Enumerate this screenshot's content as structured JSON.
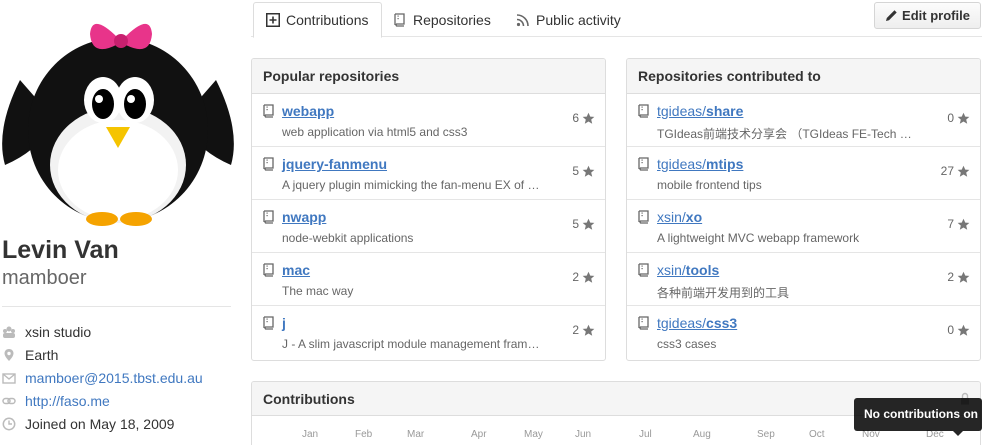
{
  "profile": {
    "full_name": "Levin Van",
    "username": "mamboer",
    "details": [
      {
        "icon": "organization-icon",
        "text": "xsin studio",
        "link": false
      },
      {
        "icon": "location-icon",
        "text": "Earth",
        "link": false
      },
      {
        "icon": "mail-icon",
        "text": "mamboer@2015.tbst.edu.au",
        "link": true
      },
      {
        "icon": "link-icon",
        "text": "http://faso.me",
        "link": true
      },
      {
        "icon": "clock-icon",
        "text": "Joined on May 18, 2009",
        "link": false
      }
    ]
  },
  "tabs": [
    {
      "label": "Contributions",
      "icon": "contributions-icon",
      "selected": true
    },
    {
      "label": "Repositories",
      "icon": "repo-icon",
      "selected": false
    },
    {
      "label": "Public activity",
      "icon": "rss-icon",
      "selected": false
    }
  ],
  "edit_profile_label": "Edit profile",
  "popular": {
    "title": "Popular repositories",
    "repos": [
      {
        "name": "webapp",
        "desc": "web application via html5 and css3",
        "stars": "6"
      },
      {
        "name": "jquery-fanmenu",
        "desc": "A jquery plugin mimicking the fan-menu EX of Path app.",
        "stars": "5"
      },
      {
        "name": "nwapp",
        "desc": "node-webkit applications",
        "stars": "5"
      },
      {
        "name": "mac",
        "desc": "The mac way",
        "stars": "2"
      },
      {
        "name": "j",
        "desc": "J - A slim javascript module management framework",
        "stars": "2"
      }
    ]
  },
  "contributed": {
    "title": "Repositories contributed to",
    "repos": [
      {
        "owner": "tgideas/",
        "name": "share",
        "desc": "TGIdeas前端技术分享会 （TGIdeas FE-Tech Share）",
        "stars": "0"
      },
      {
        "owner": "tgideas/",
        "name": "mtips",
        "desc": "mobile frontend tips",
        "stars": "27"
      },
      {
        "owner": "xsin/",
        "name": "xo",
        "desc": "A lightweight MVC webapp framework",
        "stars": "7"
      },
      {
        "owner": "xsin/",
        "name": "tools",
        "desc": "各种前端开发用到的工具",
        "stars": "2"
      },
      {
        "owner": "tgideas/",
        "name": "css3",
        "desc": "css3 cases",
        "stars": "0"
      }
    ]
  },
  "contributions": {
    "title": "Contributions",
    "months": [
      "Jan",
      "Feb",
      "Mar",
      "Apr",
      "May",
      "Jun",
      "Jul",
      "Aug",
      "Sep",
      "Oct",
      "Nov",
      "Dec"
    ],
    "tooltip": "No contributions on D"
  },
  "colors": {
    "link": "#4078c0",
    "header_bg": "#f5f5f5",
    "border": "#dddddd"
  }
}
